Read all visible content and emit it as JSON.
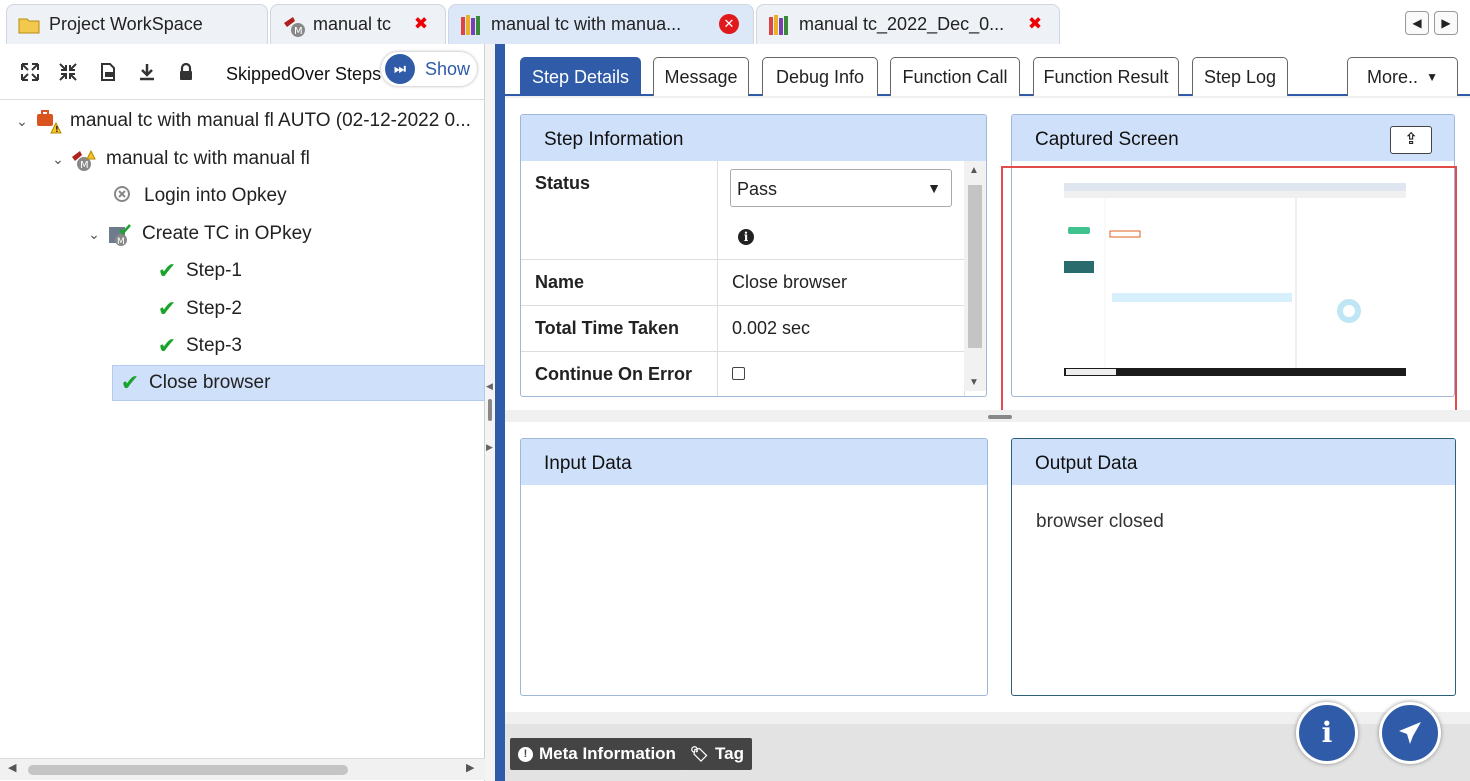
{
  "doc_tabs": [
    {
      "label": "Project WorkSpace"
    },
    {
      "label": "manual tc"
    },
    {
      "label": "manual tc with manua..."
    },
    {
      "label": "manual tc_2022_Dec_0..."
    }
  ],
  "toolbar": {
    "skipped_label": "SkippedOver Steps",
    "show_label": "Show"
  },
  "tree": [
    {
      "label": "manual tc with manual fl AUTO (02-12-2022 0..."
    },
    {
      "label": "manual tc with manual fl"
    },
    {
      "label": "Login into Opkey"
    },
    {
      "label": "Create TC in OPkey"
    },
    {
      "label": "Step-1"
    },
    {
      "label": "Step-2"
    },
    {
      "label": "Step-3"
    },
    {
      "label": "Close browser"
    }
  ],
  "detail_tabs": [
    "Step Details",
    "Message",
    "Debug Info",
    "Function Call",
    "Function Result",
    "Step Log",
    "More.."
  ],
  "step_info": {
    "title": "Step Information",
    "status_label": "Status",
    "status_value": "Pass",
    "name_label": "Name",
    "name_value": "Close browser",
    "time_label": "Total Time Taken",
    "time_value": "0.002 sec",
    "continue_label": "Continue On Error"
  },
  "captured": {
    "title": "Captured Screen"
  },
  "input_data": {
    "title": "Input Data"
  },
  "output_data": {
    "title": "Output Data",
    "value": "browser closed"
  },
  "bottom": {
    "meta_label": "Meta Information",
    "tag_label": "Tag"
  },
  "colors": {
    "accent": "#2f5ba8",
    "header": "#cfe0fa",
    "highlight": "#e34c4c",
    "pass": "#1aa32a"
  },
  "icons": [
    "folder-icon",
    "testcase-icon",
    "suite-icon",
    "close-icon",
    "expand-icon",
    "collapse-icon",
    "export-icon",
    "download-icon",
    "lock-icon",
    "skip-icon",
    "check-icon",
    "upload-icon",
    "info-icon",
    "tag-icon",
    "plane-icon"
  ]
}
